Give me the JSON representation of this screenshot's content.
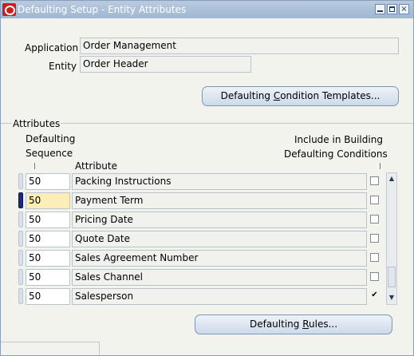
{
  "window": {
    "title": "Defaulting Setup - Entity Attributes",
    "controls": {
      "minimize": "",
      "maximize": "",
      "close": "×"
    }
  },
  "header": {
    "application_label": "Application",
    "application_value": "Order Management",
    "entity_label": "Entity",
    "entity_value": "Order Header"
  },
  "buttons": {
    "templates_pre": "Defaulting ",
    "templates_u": "C",
    "templates_post": "ondition Templates...",
    "rules_pre": "Defaulting ",
    "rules_u": "R",
    "rules_post": "ules..."
  },
  "attributes": {
    "group_label": "Attributes",
    "col_sequence_line1": "Defaulting",
    "col_sequence_line2": "Sequence",
    "col_attribute": "Attribute",
    "col_include_line1": "Include in Building",
    "col_include_line2": "Defaulting Conditions",
    "rows": [
      {
        "sequence": "50",
        "attribute": "Packing Instructions",
        "include": false,
        "active": false
      },
      {
        "sequence": "50",
        "attribute": "Payment Term",
        "include": false,
        "active": true
      },
      {
        "sequence": "50",
        "attribute": "Pricing Date",
        "include": false,
        "active": false
      },
      {
        "sequence": "50",
        "attribute": "Quote Date",
        "include": false,
        "active": false
      },
      {
        "sequence": "50",
        "attribute": "Sales Agreement Number",
        "include": false,
        "active": false
      },
      {
        "sequence": "50",
        "attribute": "Sales Channel",
        "include": false,
        "active": false
      },
      {
        "sequence": "50",
        "attribute": "Salesperson",
        "include": true,
        "active": false
      }
    ]
  },
  "icons": {
    "app": "oracle-logo-icon",
    "scroll_up": "▲",
    "scroll_down": "▼",
    "check": "✔"
  }
}
